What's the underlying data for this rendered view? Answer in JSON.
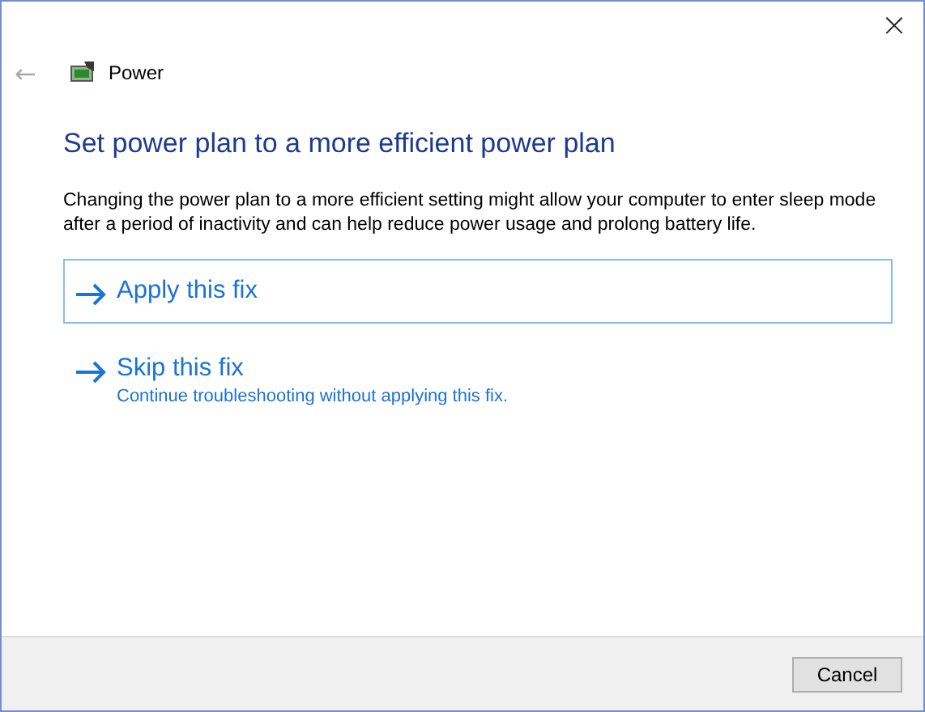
{
  "window": {
    "title": "Power",
    "close": "×",
    "back": "←"
  },
  "heading": "Set power plan to a more efficient power plan",
  "description": "Changing the power plan to a more efficient setting might allow your computer to enter sleep mode after a period of inactivity and can help reduce power usage and prolong battery life.",
  "options": [
    {
      "label": "Apply this fix",
      "selected": true
    },
    {
      "label": "Skip this fix",
      "detail": "Continue troubleshooting without applying this fix.",
      "selected": false
    }
  ],
  "buttons": [
    "Cancel"
  ]
}
